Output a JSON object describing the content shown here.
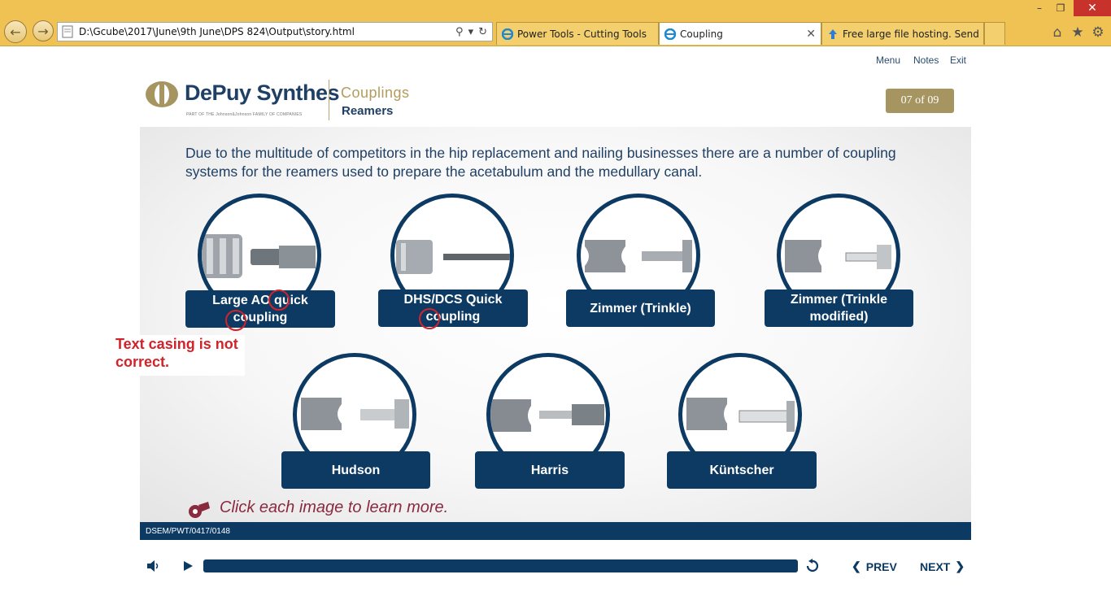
{
  "browser": {
    "address": "D:\\Gcube\\2017\\June\\9th June\\DPS 824\\Output\\story.html",
    "tabs": [
      {
        "label": "Power Tools - Cutting Tools"
      },
      {
        "label": "Coupling"
      },
      {
        "label": "Free large file hosting. Send bi..."
      }
    ]
  },
  "toplinks": {
    "menu": "Menu",
    "notes": "Notes",
    "exit": "Exit"
  },
  "logo": {
    "name": "DePuy Synthes",
    "tagline": "PART OF THE Johnson&Johnson FAMILY OF COMPANIES"
  },
  "course": {
    "title": "Couplings",
    "subtitle": "Reamers"
  },
  "counter": "07 of 09",
  "intro": "Due to the multitude of competitors in the hip replacement and nailing businesses there are a number of coupling systems for the reamers used to prepare the acetabulum and the medullary canal.",
  "couplings": [
    {
      "label": "Large AO quick coupling"
    },
    {
      "label": "DHS/DCS Quick coupling"
    },
    {
      "label": "Zimmer (Trinkle)"
    },
    {
      "label": "Zimmer (Trinkle modified)"
    },
    {
      "label": "Hudson"
    },
    {
      "label": "Harris"
    },
    {
      "label": "Küntscher"
    }
  ],
  "review_note": "Text casing is not correct.",
  "instruction": "Click each image to learn more.",
  "footer_code": "DSEM/PWT/0417/0148",
  "player": {
    "prev": "PREV",
    "next": "NEXT"
  },
  "colors": {
    "navy": "#0c3a63",
    "gold": "#a69561",
    "accent_red": "#d2232a",
    "chrome": "#f0c254"
  }
}
